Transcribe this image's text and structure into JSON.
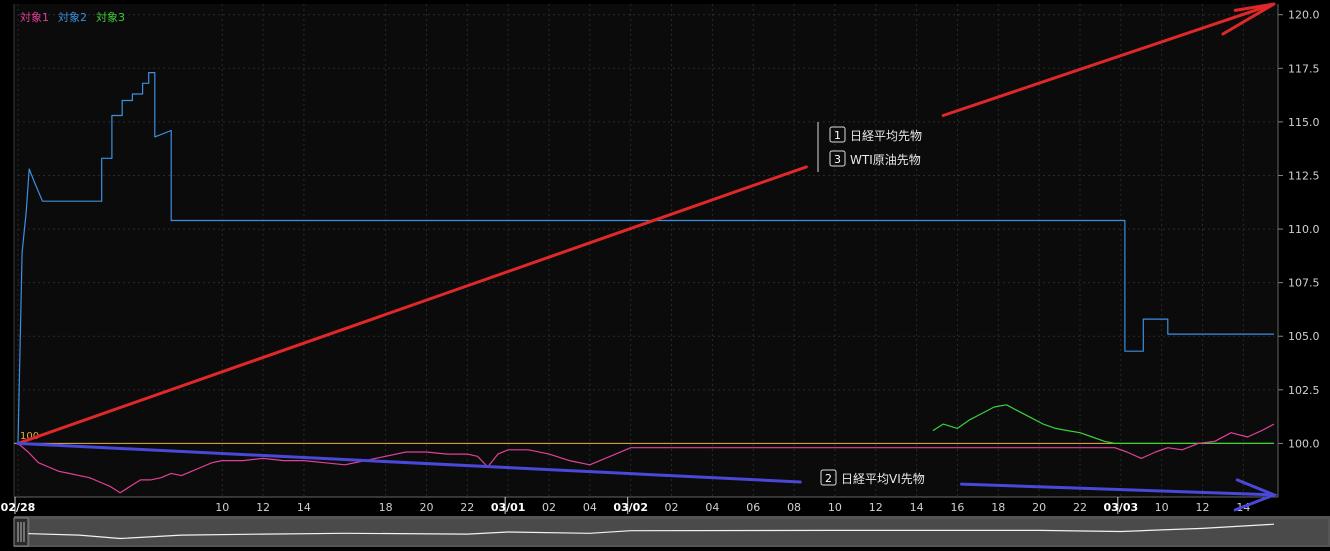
{
  "chart_data": {
    "type": "line",
    "legend": [
      "対象1",
      "対象2",
      "対象3"
    ],
    "colors": {
      "series1": "#e0409a",
      "series2": "#3d8fe0",
      "series3": "#3cd03c",
      "baseline": "#e8b040",
      "arrow_red": "#e02828",
      "arrow_blue": "#4a48d8",
      "background": "#0b0b0b",
      "grid": "#2a2a2a"
    },
    "baseline_label": "100",
    "ylim": [
      97.5,
      120.5
    ],
    "y_ticks": [
      "120.0",
      "117.5",
      "115.0",
      "112.5",
      "110.0",
      "107.5",
      "105.0",
      "102.5",
      "100.0"
    ],
    "x_ticks": [
      {
        "label": "02/28",
        "x": 0,
        "bold": true
      },
      {
        "label": "10",
        "x": 10
      },
      {
        "label": "12",
        "x": 12
      },
      {
        "label": "14",
        "x": 14
      },
      {
        "label": "18",
        "x": 18
      },
      {
        "label": "20",
        "x": 20
      },
      {
        "label": "22",
        "x": 22
      },
      {
        "label": "03/01",
        "x": 24,
        "bold": true
      },
      {
        "label": "02",
        "x": 26
      },
      {
        "label": "04",
        "x": 28
      },
      {
        "label": "03/02",
        "x": 30,
        "bold": true
      },
      {
        "label": "02",
        "x": 32
      },
      {
        "label": "04",
        "x": 34
      },
      {
        "label": "06",
        "x": 36
      },
      {
        "label": "08",
        "x": 38
      },
      {
        "label": "10",
        "x": 40
      },
      {
        "label": "12",
        "x": 42
      },
      {
        "label": "14",
        "x": 44
      },
      {
        "label": "16",
        "x": 46
      },
      {
        "label": "18",
        "x": 48
      },
      {
        "label": "20",
        "x": 50
      },
      {
        "label": "22",
        "x": 52
      },
      {
        "label": "03/03",
        "x": 54,
        "bold": true
      },
      {
        "label": "10",
        "x": 56
      },
      {
        "label": "12",
        "x": 58
      },
      {
        "label": "14",
        "x": 60
      }
    ],
    "xlim": [
      0,
      61.5
    ],
    "series": [
      {
        "name": "対象2",
        "step": true,
        "points": [
          [
            0,
            100
          ],
          [
            0.2,
            108.9
          ],
          [
            0.4,
            110.8
          ],
          [
            0.55,
            112.8
          ],
          [
            0.8,
            112.2
          ],
          [
            1.2,
            111.3
          ],
          [
            4.1,
            111.3
          ],
          [
            4.1,
            113.3
          ],
          [
            4.6,
            113.3
          ],
          [
            4.6,
            115.3
          ],
          [
            5.1,
            115.3
          ],
          [
            5.1,
            116.0
          ],
          [
            5.6,
            116.0
          ],
          [
            5.6,
            116.3
          ],
          [
            6.1,
            116.3
          ],
          [
            6.1,
            116.8
          ],
          [
            6.4,
            116.8
          ],
          [
            6.4,
            117.3
          ],
          [
            6.7,
            117.3
          ],
          [
            6.7,
            114.3
          ],
          [
            7.5,
            114.6
          ],
          [
            7.5,
            110.4
          ],
          [
            54.2,
            110.4
          ],
          [
            54.2,
            104.3
          ],
          [
            55.1,
            104.3
          ],
          [
            55.1,
            105.8
          ],
          [
            56.3,
            105.8
          ],
          [
            56.3,
            105.1
          ],
          [
            61.5,
            105.1
          ]
        ]
      },
      {
        "name": "対象3",
        "step": false,
        "points": [
          [
            44.8,
            100.6
          ],
          [
            45.3,
            100.9
          ],
          [
            46.0,
            100.7
          ],
          [
            46.6,
            101.1
          ],
          [
            47.2,
            101.4
          ],
          [
            47.8,
            101.7
          ],
          [
            48.4,
            101.8
          ],
          [
            49.0,
            101.5
          ],
          [
            49.6,
            101.2
          ],
          [
            50.2,
            100.9
          ],
          [
            50.8,
            100.7
          ],
          [
            51.4,
            100.6
          ],
          [
            52.0,
            100.5
          ],
          [
            52.6,
            100.3
          ],
          [
            53.2,
            100.1
          ],
          [
            53.7,
            100.0
          ],
          [
            61.5,
            100.0
          ]
        ]
      },
      {
        "name": "対象1",
        "step": false,
        "points": [
          [
            0,
            100.0
          ],
          [
            0.5,
            99.6
          ],
          [
            1.0,
            99.1
          ],
          [
            1.5,
            98.9
          ],
          [
            2.0,
            98.7
          ],
          [
            2.5,
            98.6
          ],
          [
            3.0,
            98.5
          ],
          [
            3.5,
            98.4
          ],
          [
            4.0,
            98.2
          ],
          [
            4.5,
            98.0
          ],
          [
            5.0,
            97.7
          ],
          [
            5.5,
            98.0
          ],
          [
            6.0,
            98.3
          ],
          [
            6.5,
            98.3
          ],
          [
            7.0,
            98.4
          ],
          [
            7.5,
            98.6
          ],
          [
            8.0,
            98.5
          ],
          [
            8.5,
            98.7
          ],
          [
            9.0,
            98.9
          ],
          [
            9.5,
            99.1
          ],
          [
            10.0,
            99.2
          ],
          [
            11.0,
            99.2
          ],
          [
            12.0,
            99.3
          ],
          [
            13.0,
            99.2
          ],
          [
            14.0,
            99.2
          ],
          [
            15.0,
            99.1
          ],
          [
            16.0,
            99.0
          ],
          [
            17.0,
            99.2
          ],
          [
            18.0,
            99.4
          ],
          [
            19.0,
            99.6
          ],
          [
            20.0,
            99.6
          ],
          [
            21.0,
            99.5
          ],
          [
            22.0,
            99.5
          ],
          [
            22.5,
            99.4
          ],
          [
            23.0,
            98.9
          ],
          [
            23.5,
            99.5
          ],
          [
            24.0,
            99.7
          ],
          [
            25.0,
            99.7
          ],
          [
            26.0,
            99.5
          ],
          [
            27.0,
            99.2
          ],
          [
            28.0,
            99.0
          ],
          [
            29.0,
            99.4
          ],
          [
            30.0,
            99.8
          ],
          [
            31.0,
            99.8
          ],
          [
            40.0,
            99.8
          ],
          [
            50.0,
            99.8
          ],
          [
            53.7,
            99.8
          ],
          [
            54.3,
            99.6
          ],
          [
            55.0,
            99.3
          ],
          [
            55.7,
            99.6
          ],
          [
            56.3,
            99.8
          ],
          [
            57.0,
            99.7
          ],
          [
            57.8,
            100.0
          ],
          [
            58.6,
            100.1
          ],
          [
            59.4,
            100.5
          ],
          [
            60.2,
            100.3
          ],
          [
            60.9,
            100.6
          ],
          [
            61.5,
            100.9
          ]
        ]
      }
    ],
    "annotations": [
      {
        "num": "1",
        "label": "日経平均先物"
      },
      {
        "num": "3",
        "label": "WTI原油先物"
      },
      {
        "num": "2",
        "label": "日経平均VI先物"
      }
    ],
    "overview": {
      "points": [
        [
          0,
          0.55
        ],
        [
          3,
          0.62
        ],
        [
          5,
          0.75
        ],
        [
          8,
          0.62
        ],
        [
          12,
          0.58
        ],
        [
          16,
          0.55
        ],
        [
          22,
          0.58
        ],
        [
          24,
          0.5
        ],
        [
          28,
          0.55
        ],
        [
          30,
          0.45
        ],
        [
          40,
          0.44
        ],
        [
          50,
          0.44
        ],
        [
          54,
          0.48
        ],
        [
          56,
          0.42
        ],
        [
          58,
          0.36
        ],
        [
          61.5,
          0.2
        ]
      ]
    }
  }
}
